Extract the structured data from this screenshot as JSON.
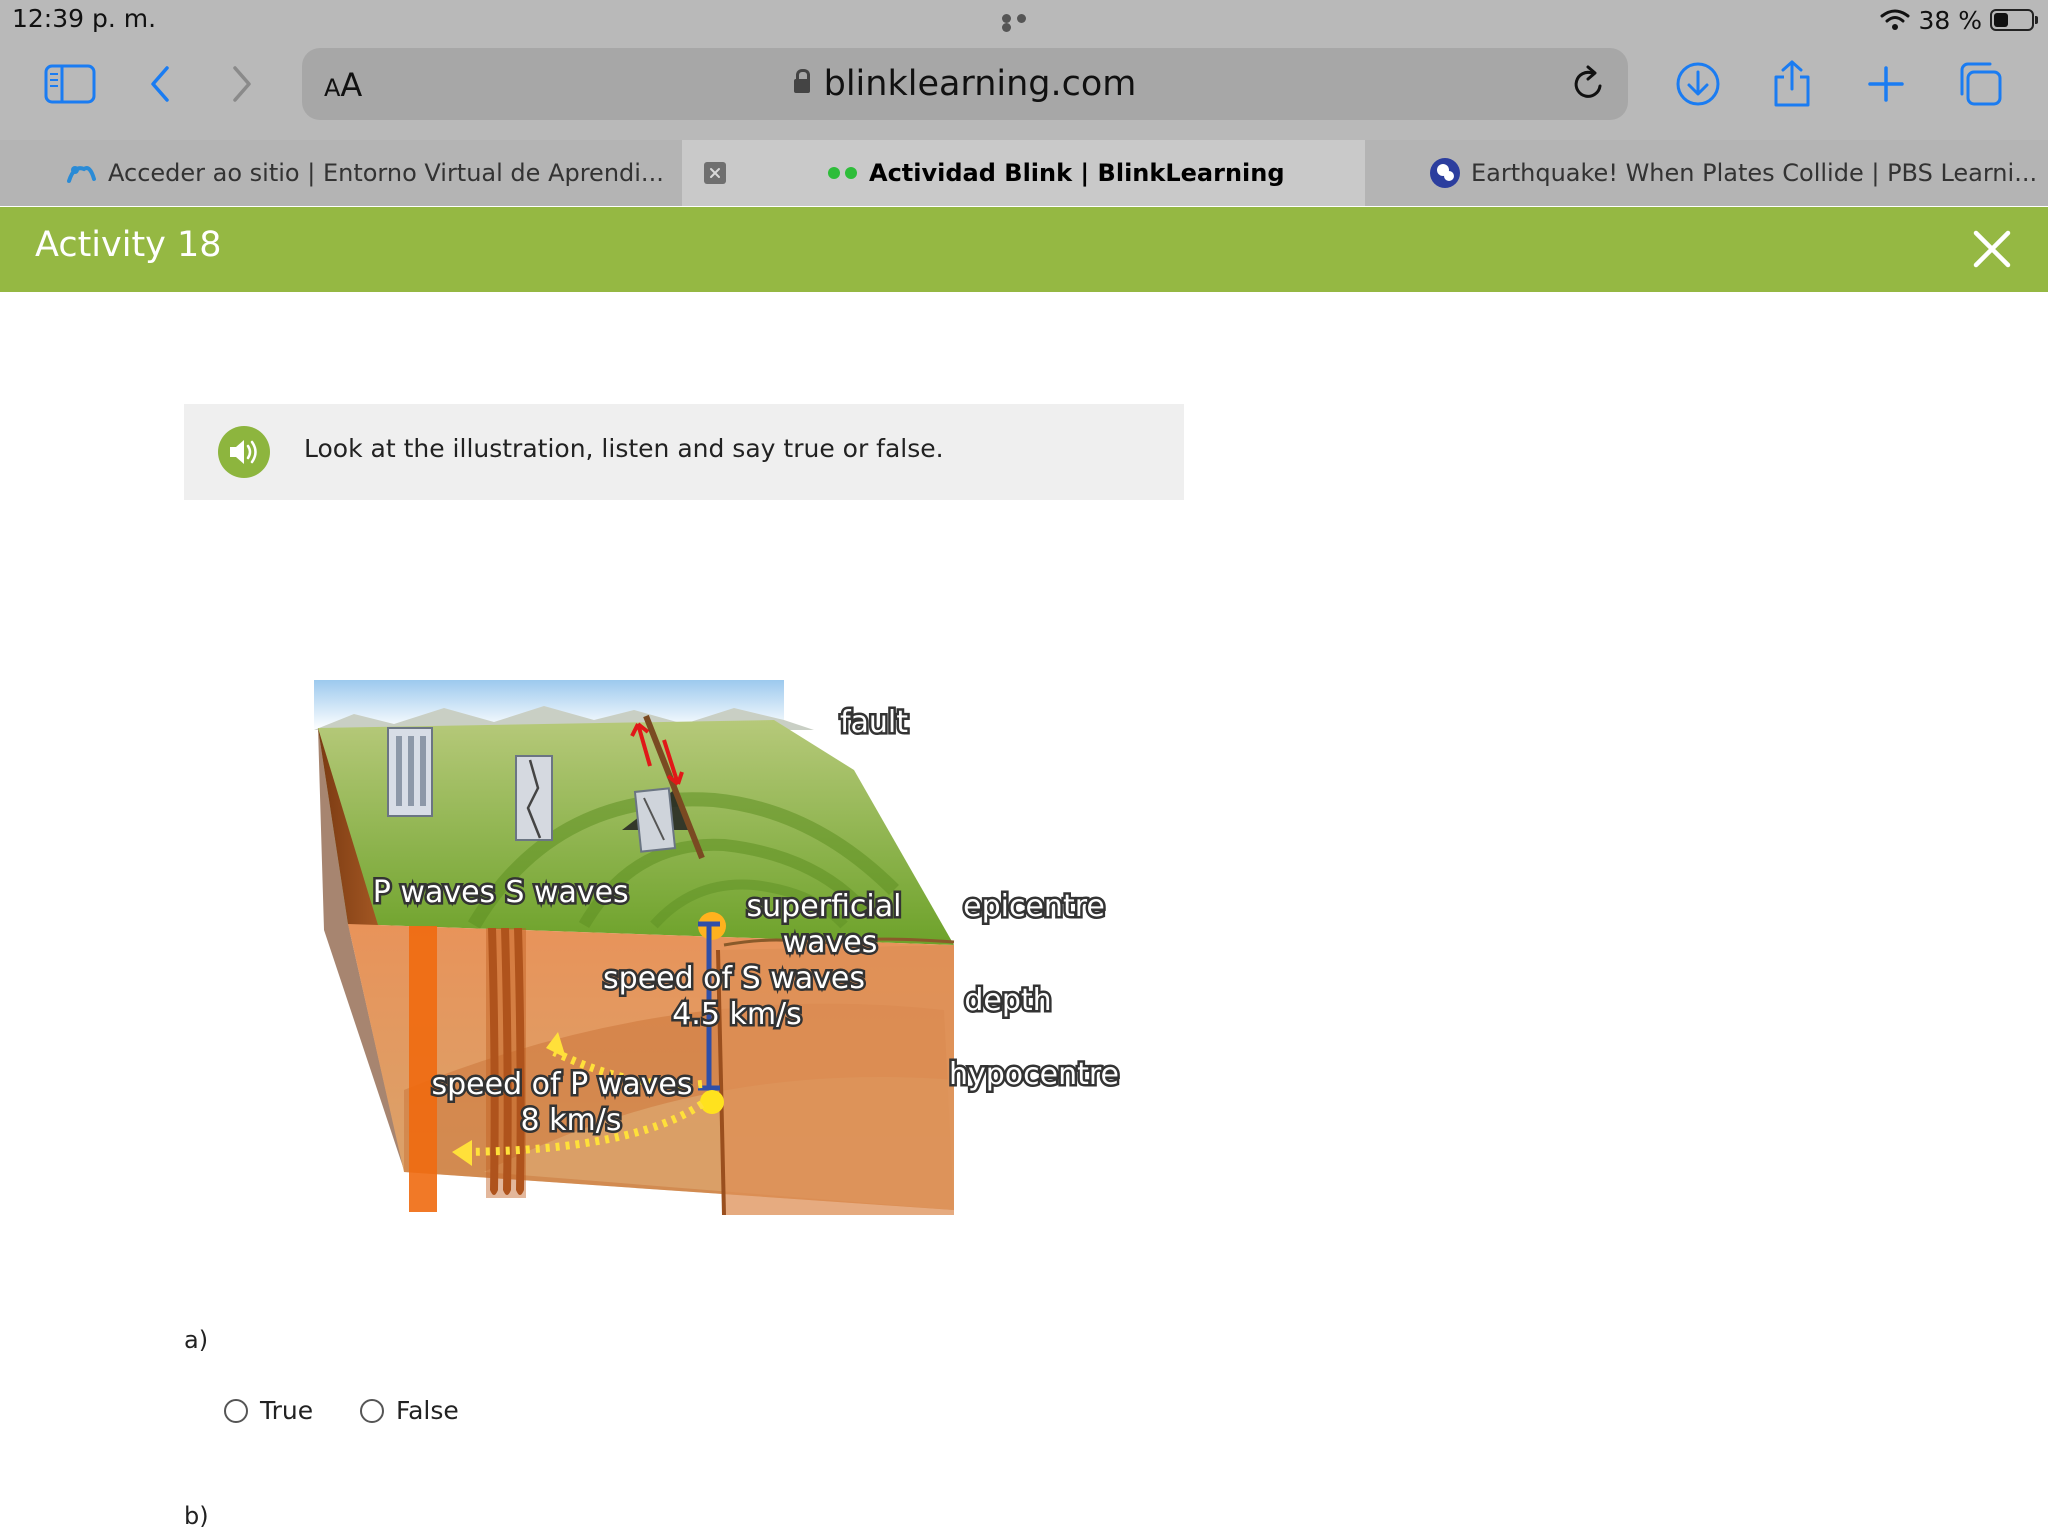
{
  "status": {
    "time": "12:39 p. m.",
    "battery": "38 %",
    "battery_level": 0.38
  },
  "toolbar": {
    "text_size_label_small": "A",
    "text_size_label": "A",
    "url": "blinklearning.com"
  },
  "tabs": [
    {
      "label": "Acceder ao sitio | Entorno Virtual de Aprendi...",
      "active": false
    },
    {
      "label": "Actividad Blink | BlinkLearning",
      "active": true
    },
    {
      "label": "Earthquake! When Plates Collide | PBS Learni...",
      "active": false
    }
  ],
  "activity": {
    "title": "Activity 18"
  },
  "instruction": {
    "text": "Look at the illustration, listen and say true or false."
  },
  "illustration": {
    "labels": {
      "fault": "fault",
      "p_waves": "P waves",
      "s_waves": "S waves",
      "superficial": "superficial",
      "waves": "waves",
      "epicentre": "epicentre",
      "speed_s": "speed of S waves",
      "speed_s_value": "4.5 km/s",
      "depth": "depth",
      "speed_p": "speed of P waves",
      "speed_p_value": "8 km/s",
      "hypocentre": "hypocentre"
    }
  },
  "questions": [
    {
      "label": "a)",
      "options": [
        "True",
        "False"
      ]
    },
    {
      "label": "b)"
    }
  ],
  "colors": {
    "accent_green": "#95b843",
    "audio_green": "#8db53e",
    "ios_blue": "#1a7cf2"
  }
}
